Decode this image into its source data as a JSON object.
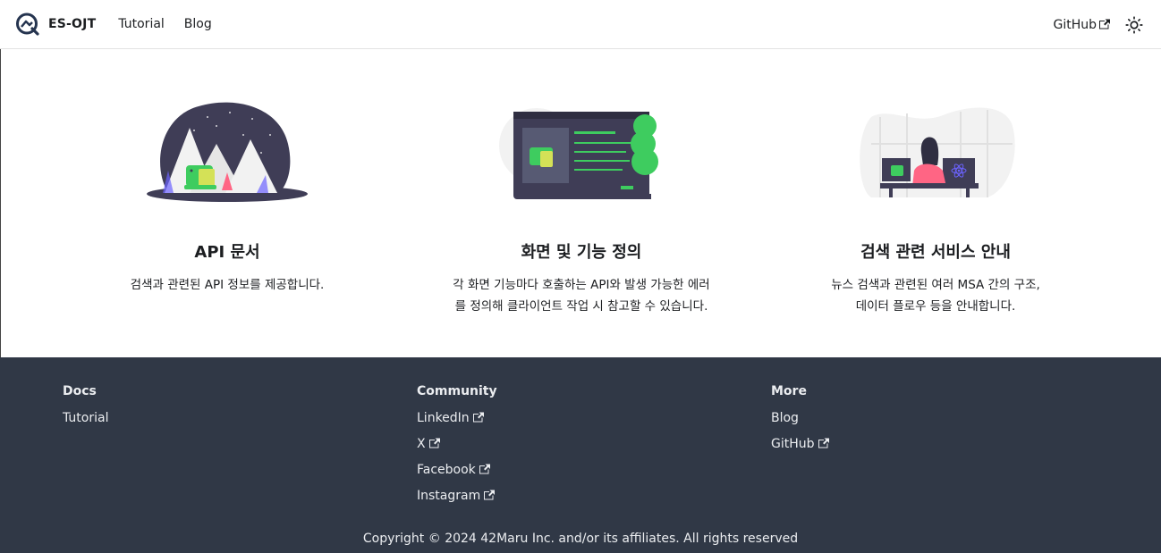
{
  "navbar": {
    "brand_title": "ES-OJT",
    "links": [
      "Tutorial",
      "Blog"
    ],
    "github_label": "GitHub",
    "icons": {
      "logo": "es-ojt-logo-icon",
      "external": "external-link-icon",
      "theme": "sun-icon"
    }
  },
  "features": [
    {
      "title": "API 문서",
      "desc_lines": [
        "검색과 관련된 API 정보를 제공합니다."
      ],
      "illustration": "mountain-dinosaur-illustration"
    },
    {
      "title": "화면 및 기능 정의",
      "desc_lines": [
        "각 화면 기능마다 호출하는 API와 발생 가능한 에러",
        "를 정의해 클라이언트 작업 시 참고할 수 있습니다."
      ],
      "illustration": "browser-dinosaur-tree-illustration"
    },
    {
      "title": "검색 관련 서비스 안내",
      "desc_lines": [
        "뉴스 검색과 관련된 여러 MSA 간의 구조,",
        "데이터 플로우 등을 안내합니다."
      ],
      "illustration": "person-monitors-react-illustration"
    }
  ],
  "footer": {
    "columns": [
      {
        "title": "Docs",
        "items": [
          "Tutorial"
        ]
      },
      {
        "title": "Community",
        "items": [
          "LinkedIn",
          "X",
          "Facebook",
          "Instagram"
        ]
      },
      {
        "title": "More",
        "items": [
          "Blog",
          "GitHub"
        ]
      }
    ],
    "copyright": "Copyright © 2024 42Maru Inc. and/or its affiliates. All rights reserved"
  },
  "colors": {
    "accent_green": "#3ecc5f",
    "dark_navy": "#303846",
    "illustration_dark": "#3f3d56",
    "pink": "#ff6584"
  }
}
